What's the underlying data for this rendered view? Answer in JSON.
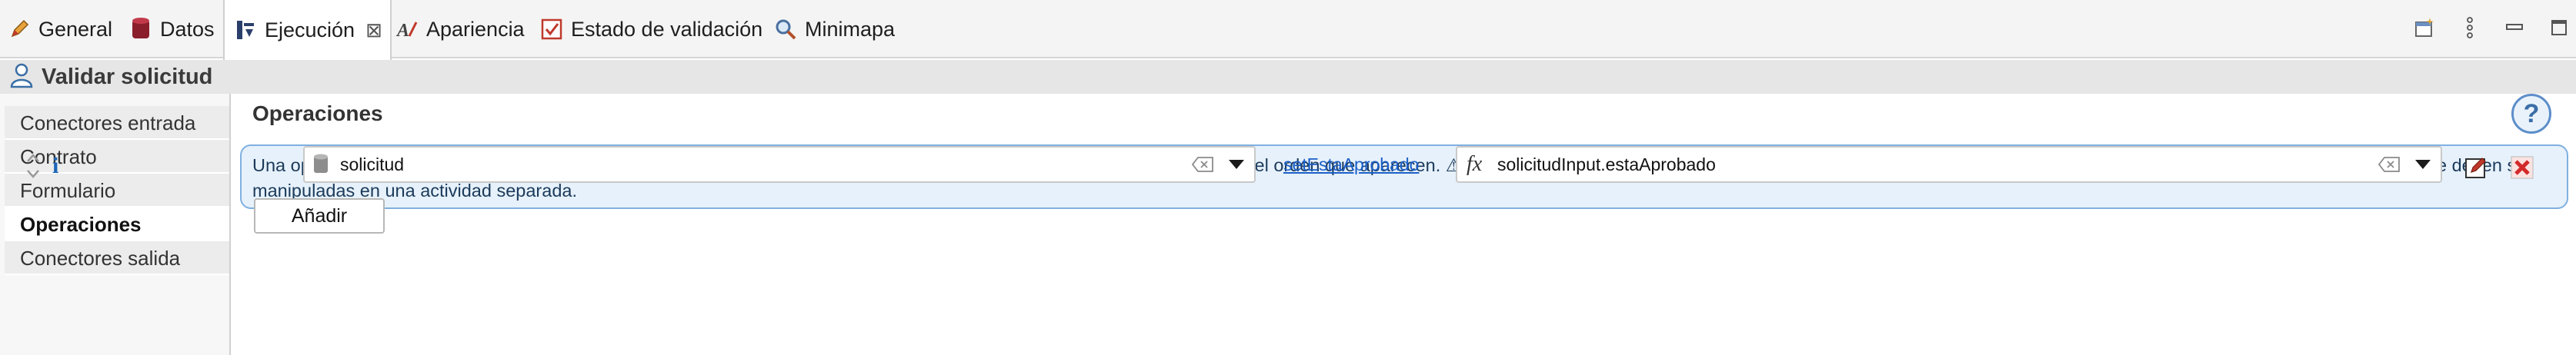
{
  "tabs": [
    {
      "label": "General",
      "icon": "pencil-icon"
    },
    {
      "label": "Datos",
      "icon": "database-icon"
    },
    {
      "label": "Ejecución",
      "icon": "execution-icon",
      "active": true,
      "close": "⊠"
    },
    {
      "label": "Apariencia",
      "icon": "appearance-icon"
    },
    {
      "label": "Estado de validación",
      "icon": "validation-check-icon"
    },
    {
      "label": "Minimapa",
      "icon": "magnifier-icon"
    }
  ],
  "toolbar_right": [
    "new-view-icon",
    "view-menu-icon",
    "minimize-icon",
    "maximize-icon"
  ],
  "header": {
    "title": "Validar solicitud",
    "icon": "user-task-icon"
  },
  "sidebar": {
    "items": [
      {
        "label": "Conectores entrada",
        "selected": false
      },
      {
        "label": "Contrato",
        "selected": false
      },
      {
        "label": "Formulario",
        "selected": false
      },
      {
        "label": "Operaciones",
        "selected": true
      },
      {
        "label": "Conectores salida",
        "selected": false
      }
    ]
  },
  "main": {
    "title": "Operaciones",
    "help": "?",
    "info_text": "Una operación actualiza el valor de una variable después de que la tarea se haya realizado. Las operaciones se ejecutan en el orden que aparecen. ⚠ La operación de eliminar debe definirse en una actividad dedicada. Otras operaciones que recrean o actualizan la variable deben ser manipuladas en una actividad separada."
  },
  "operation": {
    "info_marker": "i",
    "target_variable": "solicitud",
    "operator_link": "setEstaAprobado",
    "expression_prefix": "fx",
    "expression_value": "solicitudInput.estaAprobado"
  },
  "add_button": "Añadir",
  "colors": {
    "accent": "#1b5fc9",
    "info_bg": "#e6f1fb",
    "info_border": "#80b0e0",
    "delete": "#d22a2a"
  }
}
